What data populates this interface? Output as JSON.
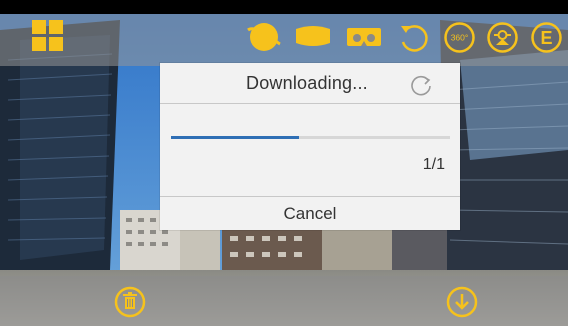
{
  "colors": {
    "accent": "#f6c21c",
    "progress": "#2f6fb5"
  },
  "topbar": {
    "icons": [
      "grid-icon",
      "planet-view-icon",
      "panorama-icon",
      "vr-glasses-icon",
      "rotate-icon",
      "view-360-icon",
      "gyro-icon",
      "edit-mode-icon"
    ],
    "view_360_label": "360°",
    "edit_label": "E"
  },
  "dialog": {
    "title": "Downloading...",
    "progress": 0.46,
    "count": "1/1",
    "cancel_label": "Cancel"
  },
  "bottombar": {
    "icons": [
      "trash-icon",
      "download-icon"
    ]
  }
}
